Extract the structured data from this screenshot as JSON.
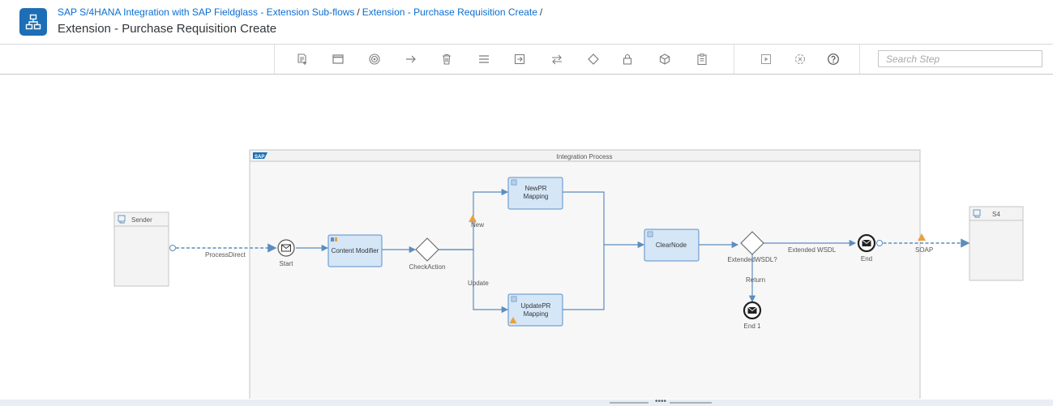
{
  "header": {
    "breadcrumb": {
      "package": "SAP S/4HANA Integration with SAP Fieldglass - Extension Sub-flows",
      "artifact": "Extension - Purchase Requisition Create",
      "separator": "/"
    },
    "title": "Extension - Purchase Requisition Create"
  },
  "toolbar": {
    "search_placeholder": "Search Step",
    "icons": [
      "add-step-icon",
      "window-icon",
      "target-icon",
      "arrow-right-icon",
      "trash-icon",
      "menu-icon",
      "import-icon",
      "swap-icon",
      "diamond-icon",
      "lock-icon",
      "package-icon",
      "clipboard-icon",
      "run-icon",
      "cancel-icon",
      "help-icon"
    ]
  },
  "diagram": {
    "pool_title": "Integration Process",
    "pool_logo": "SAP",
    "sender": {
      "label": "Sender"
    },
    "receiver": {
      "label": "S4"
    },
    "steps": {
      "start": "Start",
      "content_modifier": "Content Modifier",
      "check_action": "CheckAction",
      "new_pr_line1": "NewPR",
      "new_pr_line2": "Mapping",
      "update_pr_line1": "UpdatePR",
      "update_pr_line2": "Mapping",
      "clear_node": "ClearNode",
      "extended_wsdl": "ExtendedWSDL?",
      "end": "End",
      "end1": "End 1"
    },
    "edges": {
      "process_direct": "ProcessDirect",
      "new": "New",
      "update": "Update",
      "extended_wsdl_route": "Extended WSDL",
      "return": "Return",
      "soap": "SOAP"
    }
  },
  "colors": {
    "link": "#0a6ed1",
    "app_icon": "#1c6fb6",
    "step_fill": "#d5e6f7",
    "step_border": "#5b8fc9",
    "edge": "#5b8dbf",
    "warning": "#e9a23b"
  }
}
